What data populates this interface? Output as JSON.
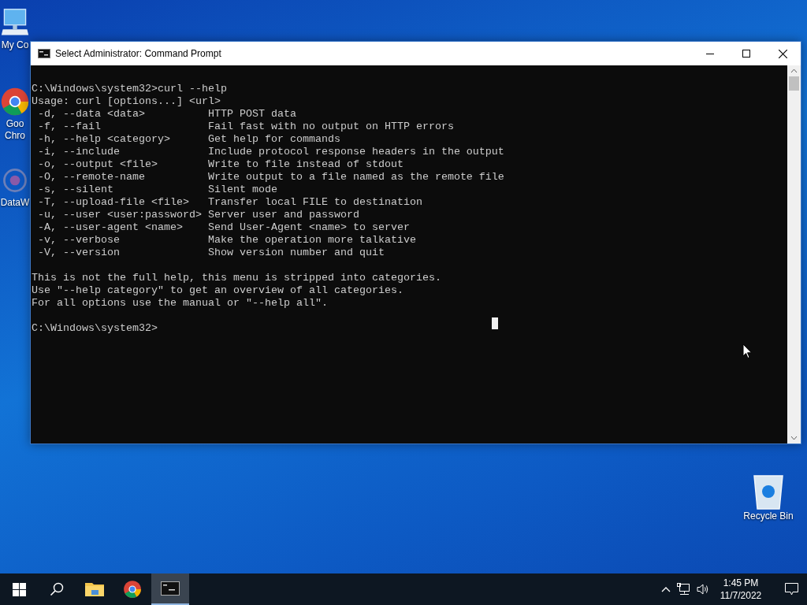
{
  "desktop_icons": [
    {
      "kind": "computer",
      "label": [
        "My Co"
      ]
    },
    {
      "kind": "browser",
      "label": [
        "Goo",
        "Chro"
      ]
    },
    {
      "kind": "app",
      "label": [
        "DataW"
      ]
    },
    {
      "kind": "recycle",
      "label": [
        "Recycle Bin"
      ]
    }
  ],
  "window": {
    "title": "Select Administrator: Command Prompt",
    "console_blocks": [
      [
        "C:\\Windows\\system32>curl --help",
        "Usage: curl [options...] <url>",
        " -d, --data <data>          HTTP POST data",
        " -f, --fail                 Fail fast with no output on HTTP errors",
        " -h, --help <category>      Get help for commands",
        " -i, --include              Include protocol response headers in the output",
        " -o, --output <file>        Write to file instead of stdout",
        " -O, --remote-name          Write output to a file named as the remote file",
        " -s, --silent               Silent mode",
        " -T, --upload-file <file>   Transfer local FILE to destination",
        " -u, --user <user:password> Server user and password",
        " -A, --user-agent <name>    Send User-Agent <name> to server",
        " -v, --verbose              Make the operation more talkative",
        " -V, --version              Show version number and quit"
      ],
      [
        "This is not the full help, this menu is stripped into categories.",
        "Use \"--help category\" to get an overview of all categories.",
        "For all options use the manual or \"--help all\"."
      ],
      [
        "C:\\Windows\\system32>"
      ]
    ]
  },
  "taskbar": {
    "items": [
      {
        "kind": "start",
        "selected": false
      },
      {
        "kind": "search",
        "selected": false
      },
      {
        "kind": "folder",
        "selected": false
      },
      {
        "kind": "browser",
        "selected": false
      },
      {
        "kind": "terminal",
        "selected": true
      }
    ],
    "clock_time": "1:45 PM",
    "clock_date": "11/7/2022"
  }
}
